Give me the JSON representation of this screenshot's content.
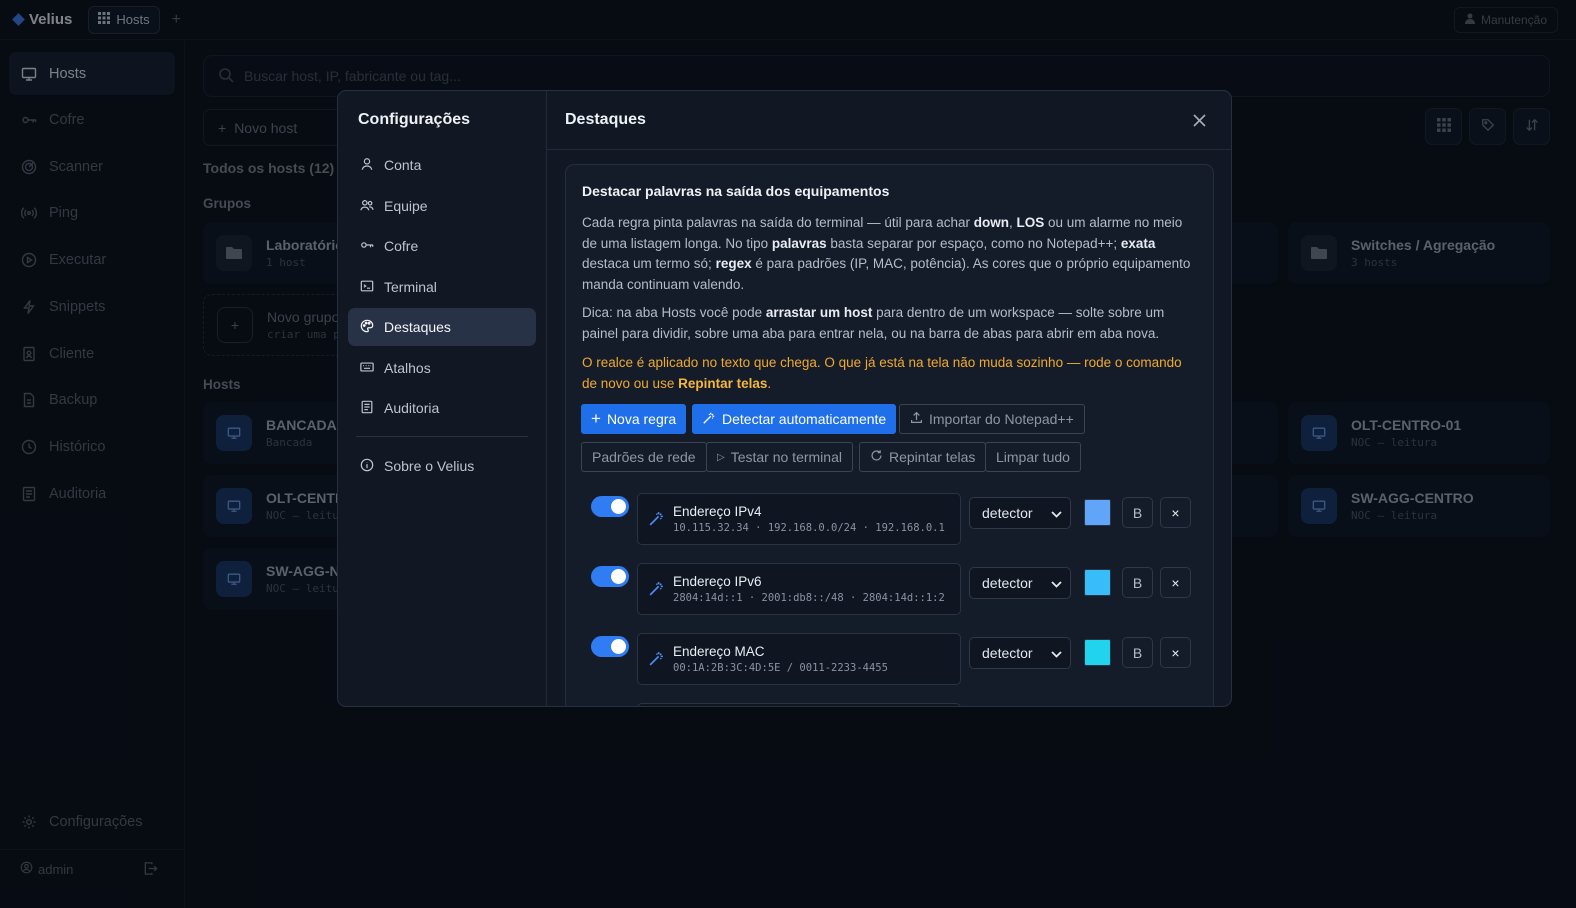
{
  "app": {
    "brand": "Velius",
    "tab_label": "Hosts",
    "maintenance_label": "Manutenção"
  },
  "sidebar": {
    "items": [
      {
        "label": "Hosts",
        "icon": "monitor-icon",
        "active": true
      },
      {
        "label": "Cofre",
        "icon": "key-icon"
      },
      {
        "label": "Scanner",
        "icon": "radar-icon"
      },
      {
        "label": "Ping",
        "icon": "signal-icon"
      },
      {
        "label": "Executar",
        "icon": "play-icon"
      },
      {
        "label": "Snippets",
        "icon": "bolt-icon"
      },
      {
        "label": "Cliente",
        "icon": "badge-icon"
      },
      {
        "label": "Backup",
        "icon": "file-icon"
      },
      {
        "label": "Histórico",
        "icon": "clock-icon"
      },
      {
        "label": "Auditoria",
        "icon": "list-icon"
      }
    ],
    "settings_label": "Configurações",
    "user_label": "admin"
  },
  "main": {
    "search_placeholder": "Buscar host, IP, fabricante ou tag...",
    "new_host_label": "Novo host",
    "all_hosts_label": "Todos os hosts (12)",
    "groups_label": "Grupos",
    "hosts_label": "Hosts",
    "groups": [
      {
        "name": "Laboratório",
        "sub": "1 host"
      },
      {
        "name": "Switches / Agregação",
        "sub": "3 hosts"
      }
    ],
    "new_group": {
      "name": "Novo grupo",
      "sub": "criar uma p"
    },
    "hosts": [
      {
        "name": "BANCADA-",
        "sub": "Bancada"
      },
      {
        "name": "OLT-CENTR",
        "sub": "NOC — leitu"
      },
      {
        "name": "SW-AGG-N",
        "sub": "NOC — leitu"
      },
      {
        "name": "OLT-CENTRO-01",
        "sub": "NOC — leitura"
      },
      {
        "name": "SW-AGG-CENTRO",
        "sub": "NOC — leitura"
      }
    ]
  },
  "modal": {
    "nav_title": "Configurações",
    "nav_items": [
      "Conta",
      "Equipe",
      "Cofre",
      "Terminal",
      "Destaques",
      "Atalhos",
      "Auditoria"
    ],
    "about_label": "Sobre o Velius",
    "title": "Destaques",
    "panel": {
      "heading": "Destacar palavras na saída dos equipamentos",
      "p1": [
        {
          "t": "Cada regra pinta palavras na saída do terminal — útil para achar "
        },
        {
          "t": "down",
          "b": true
        },
        {
          "t": ", "
        },
        {
          "t": "LOS",
          "b": true
        },
        {
          "t": " ou um alarme no meio de uma listagem longa. No tipo "
        },
        {
          "t": "palavras",
          "b": true
        },
        {
          "t": " basta separar por espaço, como no Notepad++; "
        },
        {
          "t": "exata",
          "b": true
        },
        {
          "t": " destaca um termo só; "
        },
        {
          "t": "regex",
          "b": true
        },
        {
          "t": " é para padrões (IP, MAC, potência). As cores que o próprio equipamento manda continuam valendo."
        }
      ],
      "p2": [
        {
          "t": "Dica: na aba Hosts você pode "
        },
        {
          "t": "arrastar um host",
          "b": true
        },
        {
          "t": " para dentro de um workspace — solte sobre um painel para dividir, sobre uma aba para entrar nela, ou na barra de abas para abrir em aba nova."
        }
      ],
      "warning": [
        {
          "t": "O realce é aplicado no texto que chega. O que já está na tela não muda sozinho — rode o comando de novo ou use "
        },
        {
          "t": "Repintar telas",
          "b": true
        },
        {
          "t": "."
        }
      ],
      "buttons": {
        "new_rule": "Nova regra",
        "auto_detect": "Detectar automaticamente",
        "import_npp": "Importar do Notepad++",
        "network_defaults": "Padrões de rede",
        "test_terminal": "Testar no terminal",
        "repaint": "Repintar telas",
        "clear_all": "Limpar tudo"
      },
      "rules": [
        {
          "name": "Endereço IPv4",
          "sample": "10.115.32.34 · 192.168.0.0/24 · 192.168.0.1",
          "type": "detector",
          "color": "#60a5fa",
          "bold": "B",
          "enabled": true
        },
        {
          "name": "Endereço IPv6",
          "sample": "2804:14d::1 · 2001:db8::/48 · 2804:14d::1:2",
          "type": "detector",
          "color": "#38bdf8",
          "bold": "B",
          "enabled": true
        },
        {
          "name": "Endereço MAC",
          "sample": "00:1A:2B:3C:4D:5E / 0011-2233-4455",
          "type": "detector",
          "color": "#22d3ee",
          "bold": "B",
          "enabled": true
        }
      ]
    }
  }
}
